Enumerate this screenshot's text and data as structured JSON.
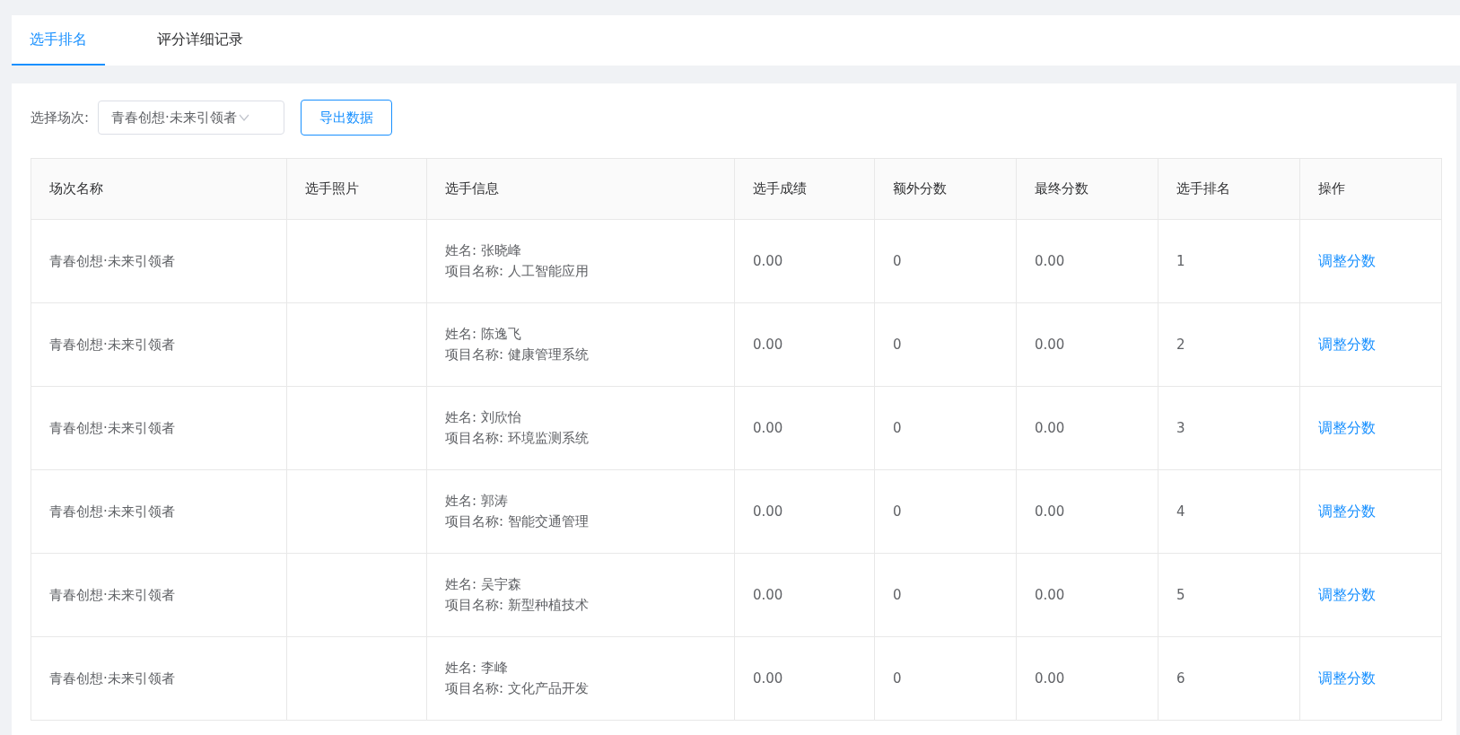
{
  "tabs": [
    {
      "label": "选手排名",
      "selected": true
    },
    {
      "label": "评分详细记录",
      "selected": false
    }
  ],
  "filter": {
    "label": "选择场次:",
    "value": "青春创想·未来引领者"
  },
  "export_button": "导出数据",
  "table": {
    "columns": [
      "场次名称",
      "选手照片",
      "选手信息",
      "选手成绩",
      "额外分数",
      "最终分数",
      "选手排名",
      "操作"
    ],
    "rows": [
      {
        "session": "青春创想·未来引领者",
        "name": "姓名: 张晓峰",
        "project": "项目名称: 人工智能应用",
        "score": "0.00",
        "extra": "0",
        "final": "0.00",
        "rank": "1",
        "action": "调整分数"
      },
      {
        "session": "青春创想·未来引领者",
        "name": "姓名: 陈逸飞",
        "project": "项目名称: 健康管理系统",
        "score": "0.00",
        "extra": "0",
        "final": "0.00",
        "rank": "2",
        "action": "调整分数"
      },
      {
        "session": "青春创想·未来引领者",
        "name": "姓名: 刘欣怡",
        "project": "项目名称: 环境监测系统",
        "score": "0.00",
        "extra": "0",
        "final": "0.00",
        "rank": "3",
        "action": "调整分数"
      },
      {
        "session": "青春创想·未来引领者",
        "name": "姓名: 郭涛",
        "project": "项目名称: 智能交通管理",
        "score": "0.00",
        "extra": "0",
        "final": "0.00",
        "rank": "4",
        "action": "调整分数"
      },
      {
        "session": "青春创想·未来引领者",
        "name": "姓名: 吴宇森",
        "project": "项目名称: 新型种植技术",
        "score": "0.00",
        "extra": "0",
        "final": "0.00",
        "rank": "5",
        "action": "调整分数"
      },
      {
        "session": "青春创想·未来引领者",
        "name": "姓名: 李峰",
        "project": "项目名称: 文化产品开发",
        "score": "0.00",
        "extra": "0",
        "final": "0.00",
        "rank": "6",
        "action": "调整分数"
      }
    ]
  }
}
